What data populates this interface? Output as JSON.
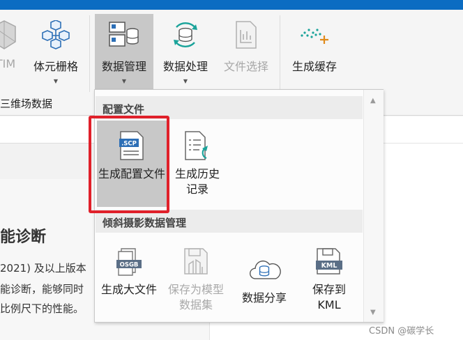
{
  "ribbon": {
    "buttons": [
      {
        "label": "TIM",
        "state": "disabled",
        "icon": "cube-grid-icon"
      },
      {
        "label": "体元栅格",
        "state": "normal",
        "icon": "voxel-grid-icon",
        "has_dropdown": true
      },
      {
        "label": "数据管理",
        "state": "active",
        "icon": "data-manage-icon",
        "has_dropdown": true
      },
      {
        "label": "数据处理",
        "state": "normal",
        "icon": "data-process-icon",
        "has_dropdown": true
      },
      {
        "label": "文件选择",
        "state": "disabled",
        "icon": "file-select-icon"
      },
      {
        "label": "生成缓存",
        "state": "normal",
        "icon": "generate-cache-icon"
      }
    ],
    "group_label": "三维场数据"
  },
  "document": {
    "heading": "能诊断",
    "lines": [
      "2021) 及以上版本",
      "能诊断，能够同时",
      "比例尺下的性能。"
    ]
  },
  "dropdown": {
    "sections": [
      {
        "title": "配置文件",
        "items": [
          {
            "label": "生成配置文件",
            "icon": "scp-file-icon",
            "selected": true
          },
          {
            "label": "生成历史记录",
            "icon": "history-record-icon"
          }
        ]
      },
      {
        "title": "倾斜摄影数据管理",
        "items": [
          {
            "label": "生成大文件",
            "icon": "osgb-file-icon"
          },
          {
            "label": "保存为模型数据集",
            "icon": "save-model-dataset-icon",
            "disabled": true
          },
          {
            "label": "数据分享",
            "icon": "data-share-icon"
          },
          {
            "label": "保存到KML",
            "icon": "kml-file-icon"
          }
        ]
      }
    ]
  },
  "watermark": "CSDN @碳学长",
  "colors": {
    "title_bar": "#0b6cc2",
    "highlight_border": "#e0202a",
    "accent_icon": "#2d6fb6",
    "teal_icon": "#1aa39a"
  }
}
